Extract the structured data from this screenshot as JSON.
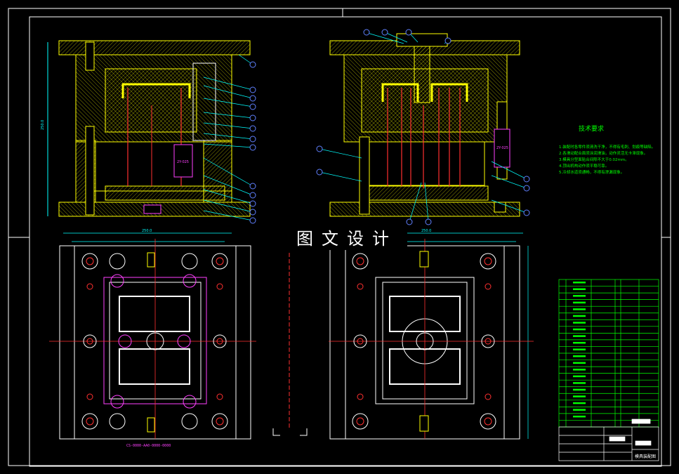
{
  "drawing": {
    "title": "模具装配图",
    "watermark": "图文设计",
    "tech_requirements_title": "技术要求",
    "tech_requirements": [
      "1.装配时各零件须清洗干净，不得有毛刺、划痕等缺陷。",
      "2.各滑动配合面须涂润滑油，动作灵活无卡滞现象。",
      "3.模具分型面贴合间隙不大于0.02mm。",
      "4.顶出机构动作须平稳可靠。",
      "5.冷却水道须通畅，不得有渗漏现象。"
    ],
    "part_label": "CS-0000-AA0-0000-0000",
    "slide_callout_1": "2Y-025",
    "slide_callout_2": "2Y-025",
    "dimension_top_left": "250.0",
    "dimension_top_right": "250.0",
    "dimension_side": "250.0",
    "colors": {
      "background": "#000000",
      "frame": "#ffffff",
      "hatch": "#d8d800",
      "outline": "#ffff00",
      "centerline": "#ff2020",
      "dimension": "#00ffff",
      "table": "#00ff00",
      "ejector": "#ff40ff",
      "balloon": "#6080ff"
    }
  },
  "bom": {
    "rows": 22,
    "columns": 6
  }
}
